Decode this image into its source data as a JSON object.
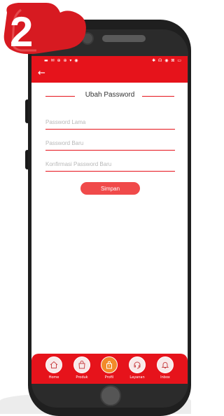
{
  "status_bar": {
    "left": "▬ ✉ ⊕ ⊕ ▾ ◉",
    "right": "✱ ☊ ◉ ⊠ ▭"
  },
  "app_bar": {
    "back_icon": "←"
  },
  "form": {
    "title": "Ubah Password",
    "fields": [
      {
        "placeholder": "Password Lama",
        "value": ""
      },
      {
        "placeholder": "Password Baru",
        "value": ""
      },
      {
        "placeholder": "Konfirmasi Password Baru",
        "value": ""
      }
    ],
    "submit_label": "Simpan"
  },
  "bottom_nav": {
    "items": [
      {
        "label": "Home",
        "icon": "home-icon"
      },
      {
        "label": "Produk",
        "icon": "shopping-bag-icon"
      },
      {
        "label": "Profil",
        "icon": "profile-bag-icon",
        "active": true
      },
      {
        "label": "Layanan",
        "icon": "headset-icon"
      },
      {
        "label": "Inbox",
        "icon": "bell-icon"
      }
    ]
  },
  "step_badge": {
    "number": "2"
  },
  "colors": {
    "primary": "#e6131b",
    "button": "#f04a4a",
    "active": "#f28b2a"
  }
}
